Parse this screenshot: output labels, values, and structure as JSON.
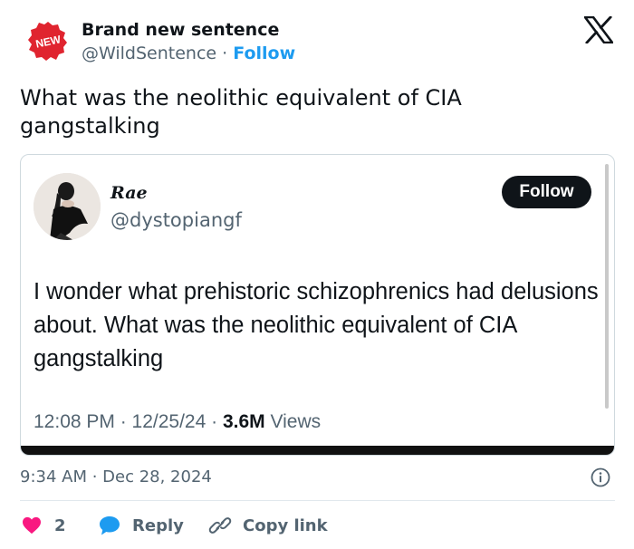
{
  "header": {
    "badge_text": "NEW",
    "author_name": "Brand new sentence",
    "handle": "@WildSentence",
    "separator": " · ",
    "follow_label": "Follow",
    "x_logo_icon": "x-logo-icon"
  },
  "tweet": {
    "text": "What was the neolithic equivalent of CIA gangstalking"
  },
  "quoted": {
    "name": "Rae",
    "handle": "@dystopiangf",
    "follow_label": "Follow",
    "text": "I wonder what prehistoric schizophrenics had delusions about. What was the neolithic equivalent of CIA gangstalking",
    "meta_time": "12:08 PM · 12/25/24 · ",
    "meta_views_count": "3.6M",
    "meta_views_label": " Views"
  },
  "footer": {
    "timestamp": "9:34 AM · Dec 28, 2024",
    "likes_count": "2",
    "reply_label": "Reply",
    "copy_link_label": "Copy link"
  },
  "colors": {
    "accent": "#1d9bf0",
    "like": "#f91880",
    "badge": "#e0242f",
    "text_secondary": "#536471"
  }
}
